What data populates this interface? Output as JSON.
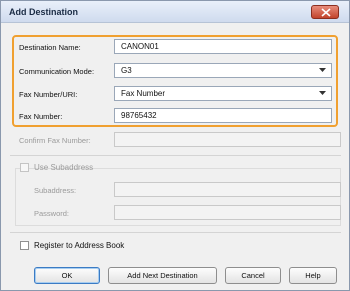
{
  "window": {
    "title": "Add Destination"
  },
  "form": {
    "destination_name": {
      "label": "Destination Name:",
      "value": "CANON01"
    },
    "communication_mode": {
      "label": "Communication Mode:",
      "value": "G3"
    },
    "fax_number_uri": {
      "label": "Fax Number/URI:",
      "value": "Fax Number"
    },
    "fax_number": {
      "label": "Fax Number:",
      "value": "98765432"
    },
    "confirm_fax_number": {
      "label": "Confirm Fax Number:",
      "value": ""
    }
  },
  "subaddress": {
    "use_label": "Use Subaddress",
    "subaddress_label": "Subaddress:",
    "password_label": "Password:",
    "checked": false
  },
  "register": {
    "label": "Register to Address Book",
    "checked": false
  },
  "buttons": {
    "ok": "OK",
    "add_next": "Add Next Destination",
    "cancel": "Cancel",
    "help": "Help"
  },
  "colors": {
    "highlight": "#f0a030",
    "close_button": "#c2442c"
  }
}
